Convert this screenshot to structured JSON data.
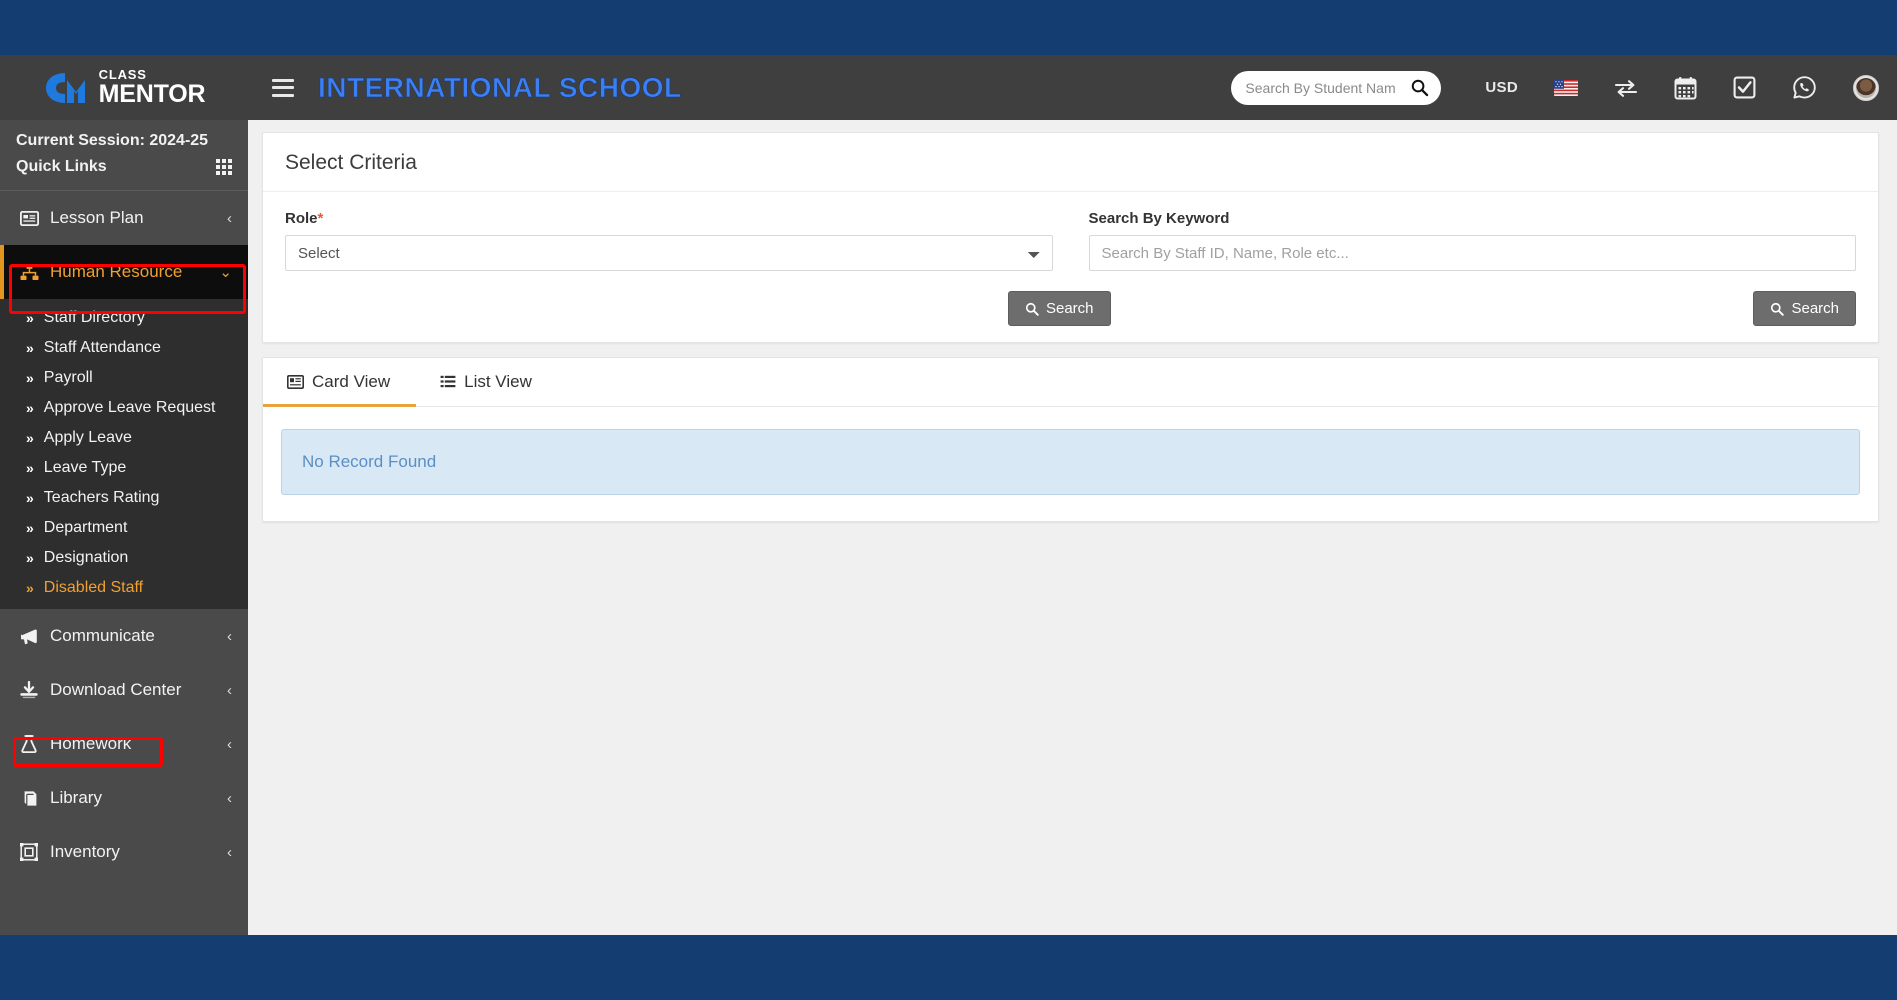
{
  "brand": {
    "logo_small": "CLASS",
    "logo_big": "MENTOR",
    "logo_mark": "cm-logo-icon"
  },
  "header": {
    "menu_toggle": "hamburger-icon",
    "school_title": "INTERNATIONAL SCHOOL",
    "search": {
      "placeholder": "Search By Student Name...",
      "value": "",
      "icon": "search-icon"
    },
    "currency": "USD",
    "flag": "us-flag-icon",
    "icons": [
      {
        "name": "transfer-icon",
        "glyph": "⇄"
      },
      {
        "name": "calendar-icon",
        "glyph": "calendar"
      },
      {
        "name": "checkbox-task-icon",
        "glyph": "checkbox"
      },
      {
        "name": "whatsapp-icon",
        "glyph": "whatsapp"
      }
    ],
    "avatar": "user-avatar"
  },
  "sidebar": {
    "session_label": "Current Session: 2024-25",
    "quick_links_label": "Quick Links",
    "quick_links_icon": "grid-icon",
    "items": [
      {
        "label": "Lesson Plan",
        "icon": "lesson-plan-icon",
        "caret": "‹",
        "state": "collapsed"
      },
      {
        "label": "Human Resource",
        "icon": "human-resource-icon",
        "caret": "⌄",
        "state": "expanded"
      },
      {
        "label": "Communicate",
        "icon": "megaphone-icon",
        "caret": "‹",
        "state": "collapsed"
      },
      {
        "label": "Download Center",
        "icon": "download-icon",
        "caret": "‹",
        "state": "collapsed"
      },
      {
        "label": "Homework",
        "icon": "flask-icon",
        "caret": "‹",
        "state": "collapsed"
      },
      {
        "label": "Library",
        "icon": "book-icon",
        "caret": "‹",
        "state": "collapsed"
      },
      {
        "label": "Inventory",
        "icon": "inventory-icon",
        "caret": "‹",
        "state": "collapsed"
      }
    ],
    "submenu": [
      {
        "label": "Staff Directory",
        "highlighted": false
      },
      {
        "label": "Staff Attendance",
        "highlighted": false
      },
      {
        "label": "Payroll",
        "highlighted": false
      },
      {
        "label": "Approve Leave Request",
        "highlighted": false
      },
      {
        "label": "Apply Leave",
        "highlighted": false
      },
      {
        "label": "Leave Type",
        "highlighted": false
      },
      {
        "label": "Teachers Rating",
        "highlighted": false
      },
      {
        "label": "Department",
        "highlighted": false
      },
      {
        "label": "Designation",
        "highlighted": false
      },
      {
        "label": "Disabled Staff",
        "highlighted": true
      }
    ]
  },
  "main": {
    "criteria_title": "Select Criteria",
    "role": {
      "label": "Role",
      "required_marker": "*",
      "selected": "Select",
      "options": [
        "Select"
      ]
    },
    "keyword": {
      "label": "Search By Keyword",
      "placeholder": "Search By Staff ID, Name, Role etc...",
      "value": ""
    },
    "search_button_left": "Search",
    "search_button_right": "Search",
    "tabs": [
      {
        "label": "Card View",
        "icon": "card-view-icon",
        "active": true
      },
      {
        "label": "List View",
        "icon": "list-view-icon",
        "active": false
      }
    ],
    "empty_message": "No Record Found"
  },
  "colors": {
    "page_band": "#143d72",
    "header_bg": "#3f3f3f",
    "sidebar_bg": "#4a4a4a",
    "submenu_bg": "#2e2e2e",
    "accent_orange": "#f0a030",
    "active_nav_bg": "#0d0d0d",
    "title_blue": "#3c7ef3",
    "highlight_red": "#ff0000",
    "info_bg": "#d9e8f5",
    "info_text": "#5b8fc4",
    "button_bg": "#6d6d6d"
  }
}
